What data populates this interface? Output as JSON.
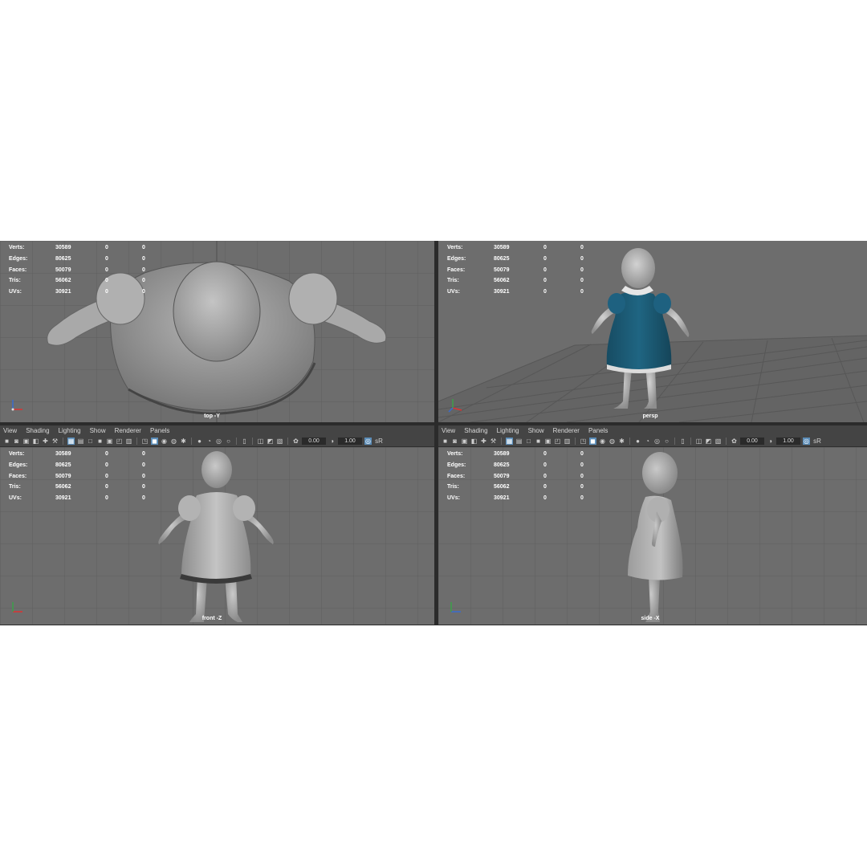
{
  "menu": [
    "View",
    "Shading",
    "Lighting",
    "Show",
    "Renderer",
    "Panels"
  ],
  "hud": {
    "rows": [
      {
        "label": "Verts:",
        "v1": "30589",
        "v2": "0",
        "v3": "0"
      },
      {
        "label": "Edges:",
        "v1": "80625",
        "v2": "0",
        "v3": "0"
      },
      {
        "label": "Faces:",
        "v1": "50079",
        "v2": "0",
        "v3": "0"
      },
      {
        "label": "Tris:",
        "v1": "56062",
        "v2": "0",
        "v3": "0"
      },
      {
        "label": "UVs:",
        "v1": "30921",
        "v2": "0",
        "v3": "0"
      }
    ]
  },
  "viewports": {
    "top": {
      "camera": "top -Y"
    },
    "persp": {
      "camera": "persp"
    },
    "front": {
      "camera": "front -Z"
    },
    "side": {
      "camera": "side -X"
    }
  },
  "toolbar": {
    "field_a": "0.00",
    "field_b": "1.00",
    "trailing_label": "sR"
  },
  "icons": {
    "camera": "camera-icon",
    "wireframe": "wireframe-icon",
    "smooth": "smooth-shade-icon",
    "textured": "textured-icon",
    "grid": "grid-toggle-icon",
    "xray": "xray-icon",
    "exposure": "exposure-icon",
    "gamma": "gamma-icon"
  },
  "colors": {
    "viewport_bg": "#6d6d6d",
    "grid_line": "#5f5f5f",
    "dress_blue": "#1d5d78",
    "model_grey": "#a8a8a8",
    "panel_bar": "#444444",
    "highlight": "#5b8db8"
  }
}
